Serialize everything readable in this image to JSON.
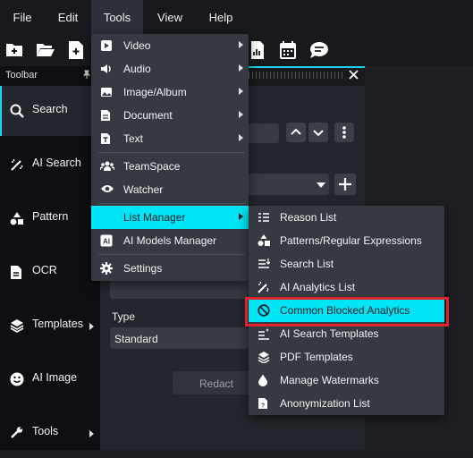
{
  "menubar": {
    "items": [
      {
        "label": "File"
      },
      {
        "label": "Edit"
      },
      {
        "label": "Tools"
      },
      {
        "label": "View"
      },
      {
        "label": "Help"
      }
    ]
  },
  "sidebar": {
    "title": "Toolbar",
    "items": [
      {
        "label": "Search",
        "icon": "search-icon"
      },
      {
        "label": "AI Search",
        "icon": "magic-wand-icon"
      },
      {
        "label": "Pattern",
        "icon": "shapes-icon"
      },
      {
        "label": "OCR",
        "icon": "document-icon"
      },
      {
        "label": "Templates",
        "icon": "layers-icon"
      },
      {
        "label": "AI Image",
        "icon": "smiley-icon"
      },
      {
        "label": "Tools",
        "icon": "toolbox-icon"
      }
    ]
  },
  "panel": {
    "type_label": "Type",
    "type_value": "Standard",
    "redact_label": "Redact"
  },
  "tools_menu": {
    "items": [
      {
        "label": "Video",
        "submenu": true
      },
      {
        "label": "Audio",
        "submenu": true
      },
      {
        "label": "Image/Album",
        "submenu": true
      },
      {
        "label": "Document",
        "submenu": true
      },
      {
        "label": "Text",
        "submenu": true
      },
      {
        "label": "TeamSpace",
        "submenu": false
      },
      {
        "label": "Watcher",
        "submenu": false
      },
      {
        "label": "List Manager",
        "submenu": true
      },
      {
        "label": "AI Models Manager",
        "submenu": false
      },
      {
        "label": "Settings",
        "submenu": false
      }
    ]
  },
  "list_manager_menu": {
    "items": [
      {
        "label": "Reason List"
      },
      {
        "label": "Patterns/Regular Expressions"
      },
      {
        "label": "Search List"
      },
      {
        "label": "AI Analytics List"
      },
      {
        "label": "Common Blocked Analytics"
      },
      {
        "label": "AI Search Templates"
      },
      {
        "label": "PDF Templates"
      },
      {
        "label": "Manage Watermarks"
      },
      {
        "label": "Anonymization List"
      }
    ]
  },
  "colors": {
    "accent": "#00e5f5",
    "highlight_border": "#e0252b"
  }
}
